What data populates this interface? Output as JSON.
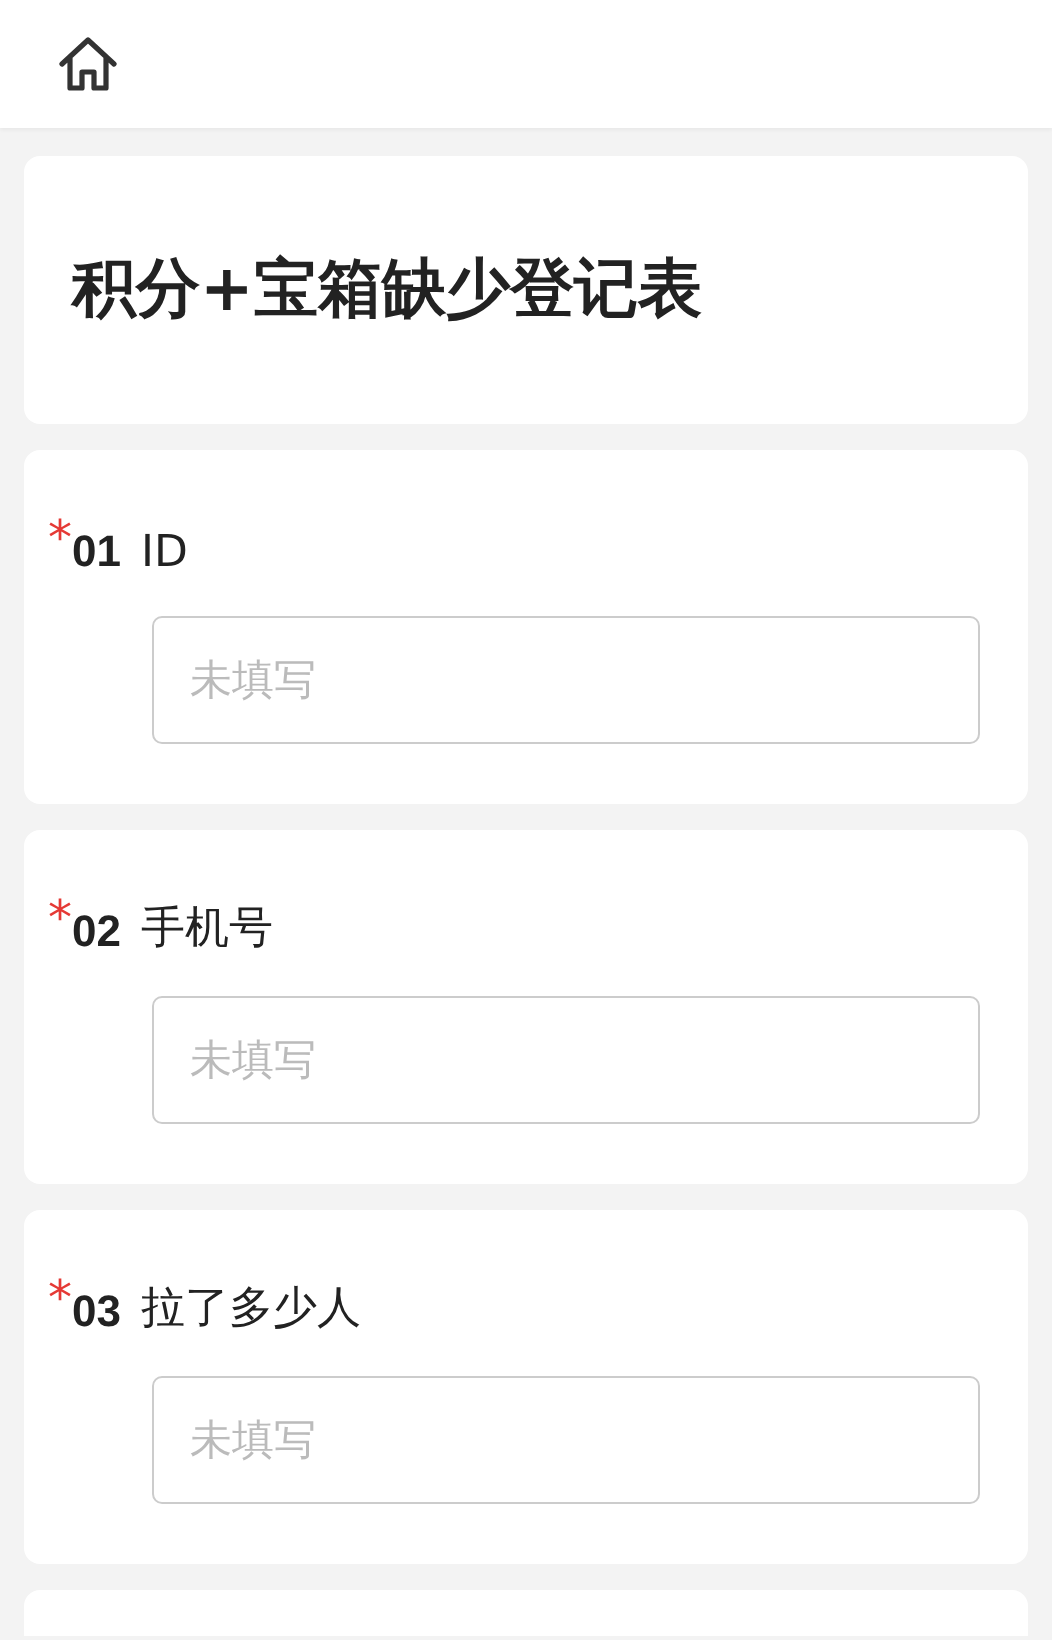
{
  "title": "积分+宝箱缺少登记表",
  "questions": [
    {
      "required_mark": "*",
      "number": "01",
      "label": "ID",
      "placeholder": "未填写"
    },
    {
      "required_mark": "*",
      "number": "02",
      "label": "手机号",
      "placeholder": "未填写"
    },
    {
      "required_mark": "*",
      "number": "03",
      "label": "拉了多少人",
      "placeholder": "未填写"
    }
  ]
}
